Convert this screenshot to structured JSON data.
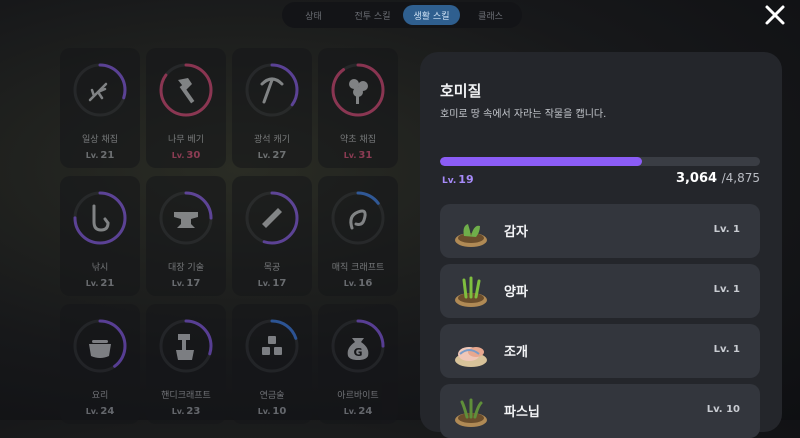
{
  "tabs": [
    {
      "label": "상태",
      "active": false
    },
    {
      "label": "전투 스킬",
      "active": false
    },
    {
      "label": "생활 스킬",
      "active": true
    },
    {
      "label": "클래스",
      "active": false
    }
  ],
  "level_prefix": "Lv.",
  "skills": [
    {
      "name": "일상 채집",
      "level": "21",
      "icon": "hand-icon",
      "progress": 0.3,
      "color": "#8b5cf6"
    },
    {
      "name": "나무 베기",
      "level": "30",
      "icon": "axe-icon",
      "progress": 0.85,
      "color": "#e0457b",
      "pink": true
    },
    {
      "name": "광석 캐기",
      "level": "27",
      "icon": "pickaxe-icon",
      "progress": 0.35,
      "color": "#8b5cf6"
    },
    {
      "name": "약초 채집",
      "level": "31",
      "icon": "herb-icon",
      "progress": 0.9,
      "color": "#e0457b",
      "pink": true
    },
    {
      "name": "낚시",
      "level": "21",
      "icon": "fishing-hook-icon",
      "progress": 0.75,
      "color": "#8b5cf6"
    },
    {
      "name": "대장 기술",
      "level": "17",
      "icon": "anvil-icon",
      "progress": 0.25,
      "color": "#8b5cf6"
    },
    {
      "name": "목공",
      "level": "17",
      "icon": "saw-icon",
      "progress": 0.55,
      "color": "#8b5cf6"
    },
    {
      "name": "매직 크래프트",
      "level": "16",
      "icon": "magic-craft-icon",
      "progress": 0.15,
      "color": "#3b82f6"
    },
    {
      "name": "요리",
      "level": "24",
      "icon": "cooking-pot-icon",
      "progress": 0.4,
      "color": "#8b5cf6"
    },
    {
      "name": "핸디크래프트",
      "level": "23",
      "icon": "hand-hammer-icon",
      "progress": 0.3,
      "color": "#8b5cf6"
    },
    {
      "name": "연금술",
      "level": "10",
      "icon": "alchemy-blocks-icon",
      "progress": 0.2,
      "color": "#3b82f6"
    },
    {
      "name": "아르바이트",
      "level": "24",
      "icon": "money-bag-icon",
      "progress": 0.25,
      "color": "#8b5cf6"
    }
  ],
  "panel": {
    "title": "호미질",
    "description": "호미로 땅 속에서 자라는 작물을 캡니다.",
    "level": "19",
    "xp_current": "3,064",
    "xp_max": "/4,875",
    "xp_progress": 0.63,
    "crops": [
      {
        "name": "감자",
        "level": "Lv. 1",
        "icon": "potato-plant-icon"
      },
      {
        "name": "양파",
        "level": "Lv. 1",
        "icon": "onion-plant-icon"
      },
      {
        "name": "조개",
        "level": "Lv. 1",
        "icon": "clam-icon"
      },
      {
        "name": "파스닙",
        "level": "Lv. 10",
        "icon": "parsnip-plant-icon"
      }
    ]
  }
}
